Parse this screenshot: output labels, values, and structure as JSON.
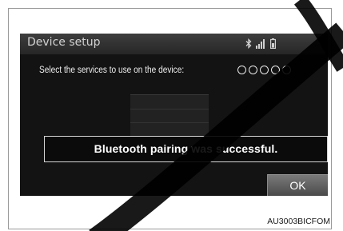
{
  "header": {
    "title": "Device setup",
    "status_icons": [
      "bluetooth-icon",
      "signal-strength-icon",
      "battery-icon"
    ]
  },
  "services": {
    "prompt": "Select the services to use on the device:",
    "indicator_count": 5
  },
  "popup": {
    "message": "Bluetooth pairing was successful."
  },
  "actions": {
    "ok_label": "OK"
  },
  "caption": "AU3003BICFOM",
  "colors": {
    "screen_background": "#131313",
    "header_gradient_top": "#3e3e3e",
    "popup_border": "#d6d6d6",
    "ok_button": "#6a6a6a",
    "watermark": "#000000"
  }
}
